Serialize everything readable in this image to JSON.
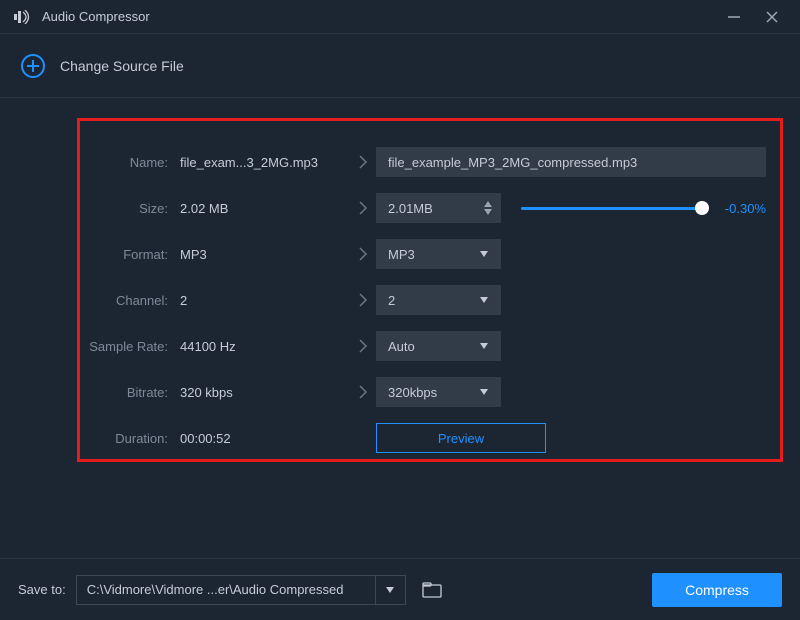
{
  "window": {
    "title": "Audio Compressor"
  },
  "actions": {
    "change_source": "Change Source File"
  },
  "labels": {
    "name": "Name:",
    "size": "Size:",
    "format": "Format:",
    "channel": "Channel:",
    "sample_rate": "Sample Rate:",
    "bitrate": "Bitrate:",
    "duration": "Duration:"
  },
  "source": {
    "name": "file_exam...3_2MG.mp3",
    "size": "2.02 MB",
    "format": "MP3",
    "channel": "2",
    "sample_rate": "44100 Hz",
    "bitrate": "320 kbps",
    "duration": "00:00:52"
  },
  "target": {
    "name": "file_example_MP3_2MG_compressed.mp3",
    "size": "2.01MB",
    "size_delta": "-0.30%",
    "format": "MP3",
    "channel": "2",
    "sample_rate": "Auto",
    "bitrate": "320kbps",
    "preview_label": "Preview"
  },
  "footer": {
    "save_to_label": "Save to:",
    "save_path": "C:\\Vidmore\\Vidmore ...er\\Audio Compressed",
    "compress_label": "Compress"
  },
  "colors": {
    "accent": "#1e90ff",
    "highlight_border": "#e51c1c"
  }
}
